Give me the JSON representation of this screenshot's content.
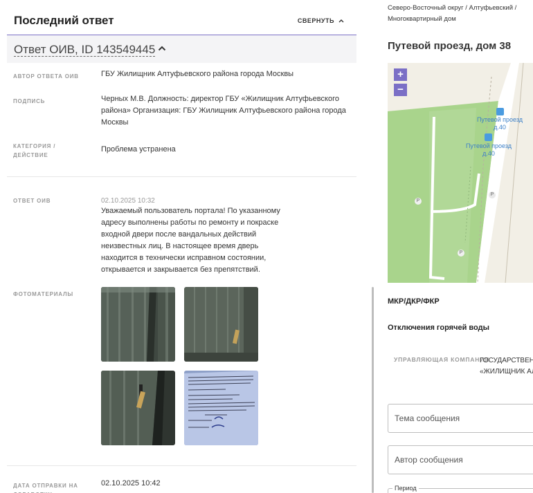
{
  "left": {
    "header_title": "Последний ответ",
    "collapse_label": "СВЕРНУТЬ",
    "answer_title": "Ответ ОИВ, ID 143549445",
    "rows": {
      "author_label": "АВТОР ОТВЕТА ОИВ",
      "author_value": "ГБУ Жилищник Алтуфьевского района города Москвы",
      "signature_label": "ПОДПИСЬ",
      "signature_value": "Черных М.В. Должность: директор ГБУ «Жилищник Алтуфьевского района» Организация: ГБУ Жилищник Алтуфьевского района города Москвы",
      "category_label": "КАТЕГОРИЯ / ДЕЙСТВИЕ",
      "category_value": "Проблема устранена",
      "answer_label": "ОТВЕТ ОИВ",
      "answer_date": "02.10.2025 10:32",
      "answer_text": "Уважаемый пользователь портала! По указанному адресу выполнены работы по ремонту и покраске входной двери после вандальных действий неизвестных лиц. В настоящее время дверь находится в технически исправном состоянии, открывается и закрывается без препятствий.",
      "photos_label": "ФОТОМАТЕРИАЛЫ",
      "sent_label": "ДАТА ОТПРАВКИ НА ДОРАБОТКУ",
      "sent_value": "02.10.2025 10:42"
    },
    "photos": [
      {
        "name": "photo-door-1"
      },
      {
        "name": "photo-door-2"
      },
      {
        "name": "photo-door-3"
      },
      {
        "name": "photo-document"
      }
    ]
  },
  "right": {
    "breadcrumb": "Северо-Восточный округ / Алтуфьевский / Многоквартирный дом",
    "address": "Путевой проезд, дом 38",
    "map": {
      "zoom_in": "+",
      "zoom_out": "−",
      "stop1_line1": "Путевой проезд",
      "stop1_line2": "д.40",
      "stop2_line1": "Путевой проезд",
      "stop2_line2": "д.40",
      "parking": "P"
    },
    "section_mkr": "МКР/ДКР/ФКР",
    "section_hot_water": "Отключения горячей воды",
    "uk_label": "УПРАВЛЯЮЩАЯ КОМПАНИЯ",
    "uk_value_line1": "ГОСУДАРСТВЕННОЕ",
    "uk_value_line2": "«ЖИЛИЩНИК АЛ",
    "topic_placeholder": "Тема сообщения",
    "author_placeholder": "Автор сообщения",
    "period_label": "Период"
  },
  "colors": {
    "accent": "#7b6fc6",
    "map_green": "#a9d48c",
    "map_bg": "#f2efe6"
  }
}
